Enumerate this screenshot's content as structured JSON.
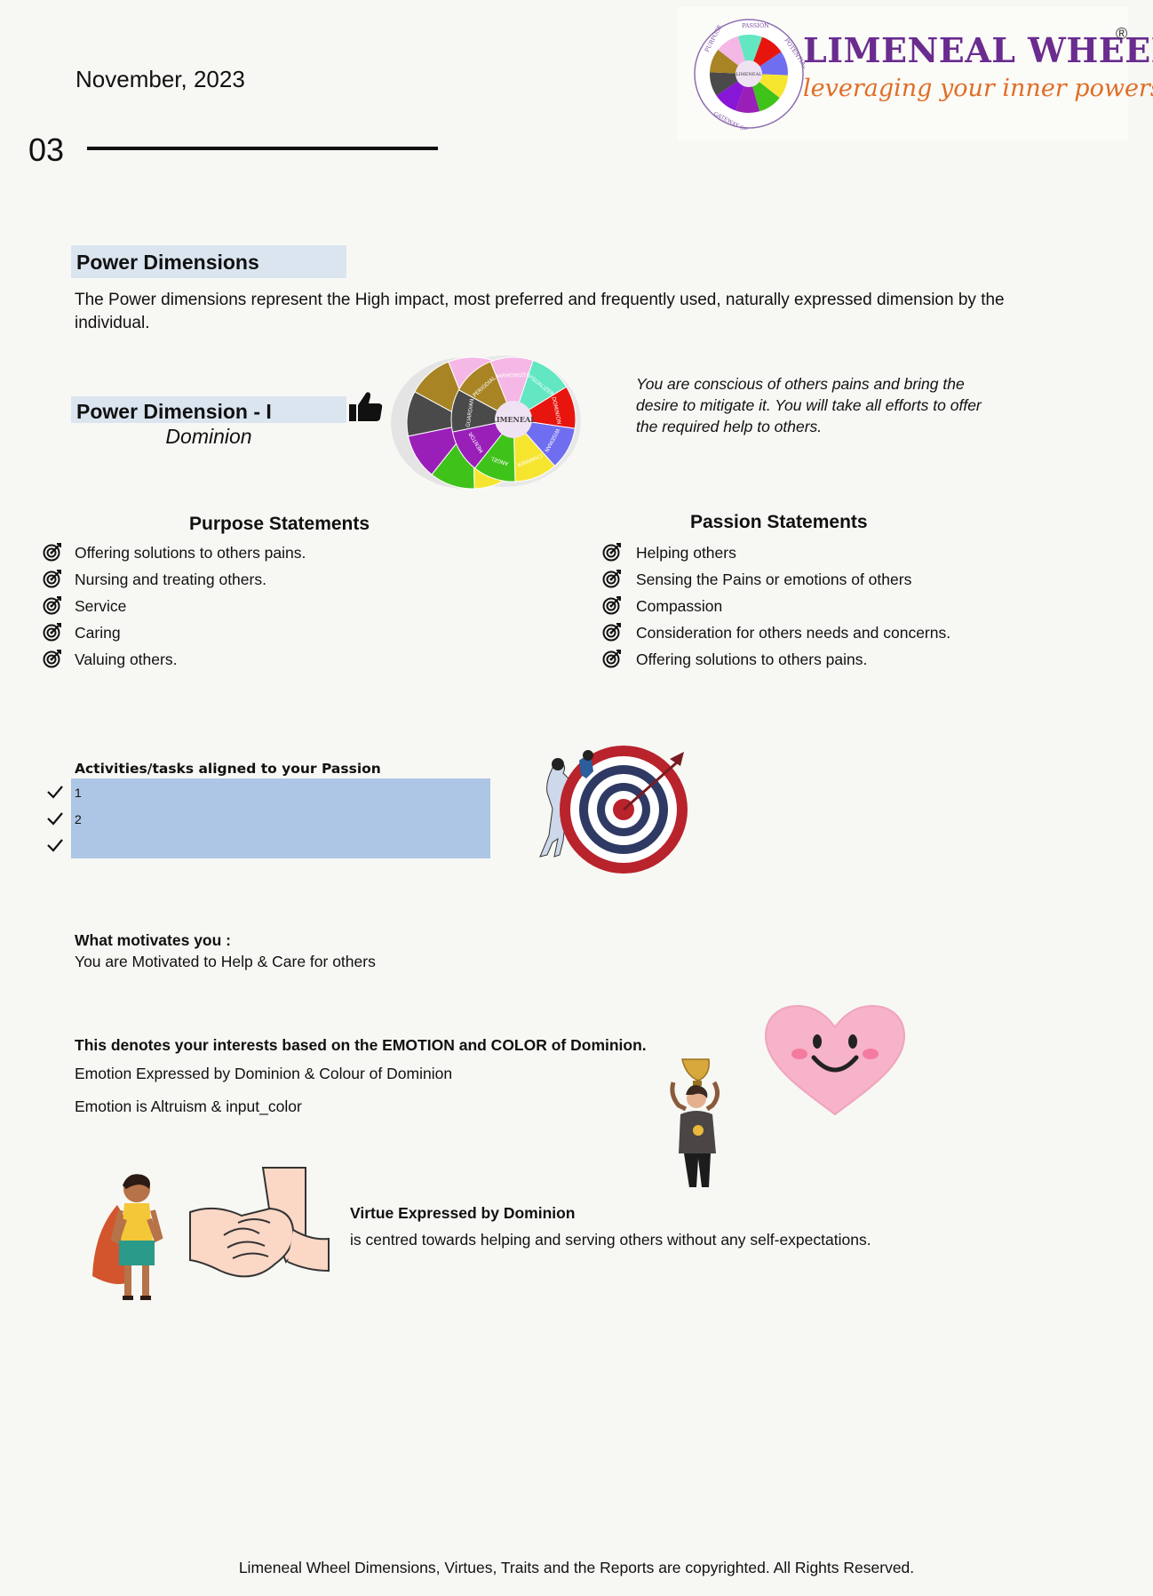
{
  "header": {
    "date": "November, 2023",
    "page_number": "03",
    "brand_title": "LIMENEAL WHEEL",
    "brand_reg": "®",
    "brand_tagline": "leveraging your inner powers",
    "logo_ring_text": [
      "PURPOSE",
      "PASSION",
      "POTENTIAL",
      "GATEWAY OF A CHAMPION"
    ],
    "logo_center": "LIMENEAL"
  },
  "power_dimensions": {
    "heading": "Power Dimensions",
    "description": "The Power dimensions represent the High impact, most preferred and frequently used, naturally expressed dimension by the individual.",
    "dimension_heading": "Power Dimension - I",
    "dimension_name": "Dominion",
    "wheel_center": "LIMENEAL",
    "wheel_segments": [
      "HARMONIZER",
      "VISUALIZER",
      "DOMINION",
      "WISEMAN",
      "CHARMER",
      "ANGEL",
      "MENTOR",
      "GUARDIAN",
      "PERIODIAL"
    ],
    "quote": "You are conscious of others pains and bring the desire to mitigate it. You will take all efforts to offer the required help to others."
  },
  "purpose": {
    "heading": "Purpose Statements",
    "items": [
      "Offering solutions to others pains.",
      "Nursing and treating others.",
      "Service",
      "Caring",
      "Valuing others."
    ]
  },
  "passion": {
    "heading": "Passion Statements",
    "items": [
      "Helping others",
      "Sensing the Pains or emotions of others",
      "Compassion",
      "Consideration for others needs and concerns.",
      "Offering solutions to others pains."
    ]
  },
  "activities": {
    "heading": "Activities/tasks aligned to your Passion",
    "items": [
      "1",
      "2",
      ""
    ]
  },
  "motivation": {
    "heading": "What motivates you :",
    "text": "You are Motivated to Help & Care for others"
  },
  "emotion": {
    "heading": "This denotes your interests based on the EMOTION and COLOR of Dominion.",
    "line1": "Emotion Expressed by Dominion & Colour of Dominion",
    "line2": "Emotion is Altruism & input_color"
  },
  "virtue": {
    "heading": "Virtue Expressed by Dominion",
    "text": "is centred towards helping and serving others without any self-expectations."
  },
  "footer": "Limeneal Wheel Dimensions, Virtues, Traits and the Reports are copyrighted. All Rights Reserved.",
  "colors": {
    "heading_bg": "#dbe5f0",
    "activity_box_bg": "#adc6e5",
    "brand_purple": "#6a2c8e",
    "brand_orange": "#e06d25",
    "dominion_red": "#e8150f"
  }
}
